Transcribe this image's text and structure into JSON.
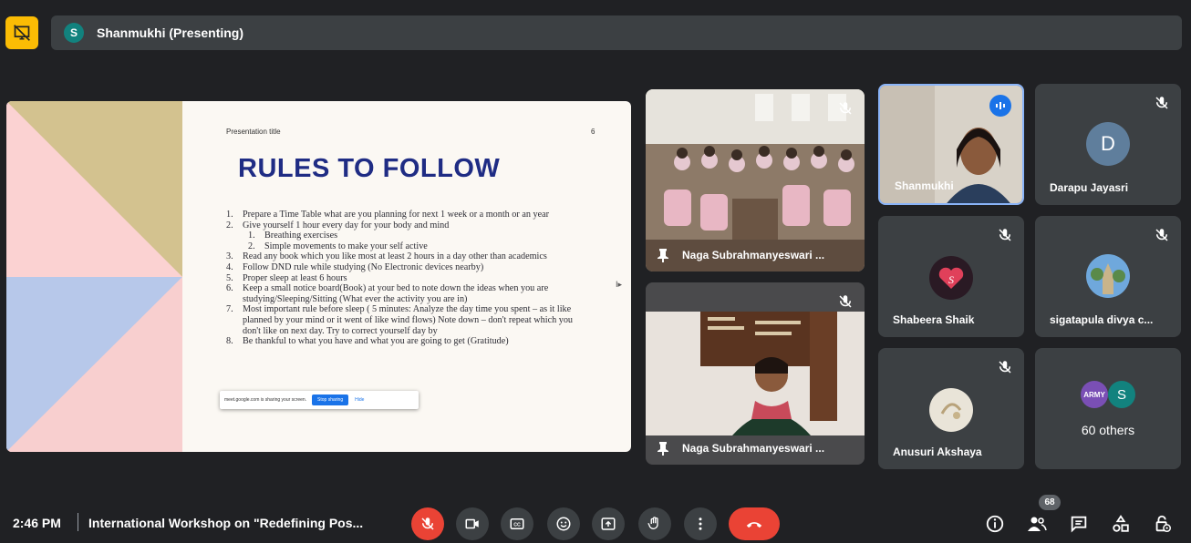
{
  "presenter_bar": {
    "avatar_letter": "S",
    "label": "Shanmukhi (Presenting)"
  },
  "slide": {
    "meta_title": "Presentation title",
    "page_number": "6",
    "heading": "RULES TO FOLLOW",
    "rules": [
      {
        "n": "1.",
        "text": "Prepare a Time Table what are you planning for next 1 week or a month or an year"
      },
      {
        "n": "2.",
        "text": "Give yourself 1 hour every day for your body and mind"
      },
      {
        "n": "1.",
        "text": "Breathing exercises",
        "sub": true
      },
      {
        "n": "2.",
        "text": "Simple movements to make your self active",
        "sub": true
      },
      {
        "n": "3.",
        "text": "Read any book which you like most at least 2 hours in a day other than academics"
      },
      {
        "n": "4.",
        "text": "Follow DND rule while studying (No Electronic devices nearby)"
      },
      {
        "n": "5.",
        "text": "Proper sleep at least 6 hours"
      },
      {
        "n": "6.",
        "text": "Keep a small notice board(Book) at your bed to note down the ideas when you are studying/Sleeping/Sitting (What ever the activity you are in)"
      },
      {
        "n": "7.",
        "text": "Most important rule before sleep ( 5 minutes: Analyze the day time you spent – as it like planned by your mind or it went of like wind flows) Note down – don't repeat which you don't like on next day. Try to correct yourself day by"
      },
      {
        "n": "8.",
        "text": "Be thankful to what you have and what you are going to get (Gratitude)"
      }
    ],
    "share_notice": {
      "text": "meet.google.com is sharing your screen.",
      "stop_label": "Stop sharing",
      "hide_label": "Hide"
    }
  },
  "tiles": {
    "classroom": {
      "name": "Naga Subrahmanyeswari ..."
    },
    "teacher": {
      "name": "Naga Subrahmanyeswari ..."
    },
    "shanmukhi": {
      "name": "Shanmukhi"
    },
    "darapu": {
      "name": "Darapu Jayasri",
      "initial": "D",
      "color": "#5f7e9c"
    },
    "shabeera": {
      "name": "Shabeera Shaik"
    },
    "sigatapula": {
      "name": "sigatapula divya c..."
    },
    "anusuri": {
      "name": "Anusuri Akshaya"
    },
    "others": {
      "label": "60 others",
      "initial": "S",
      "tag": "ARMY"
    }
  },
  "bottom_bar": {
    "time": "2:46 PM",
    "meeting_title": "International Workshop on \"Redefining Pos...",
    "participant_count": "68"
  },
  "icons": {
    "mic": "mic-off-icon",
    "camera": "camera-icon",
    "captions": "captions-icon",
    "emoji": "emoji-icon",
    "present": "present-screen-icon",
    "hand": "raise-hand-icon",
    "more": "more-vert-icon",
    "leave": "end-call-icon",
    "info": "info-icon",
    "people": "people-icon",
    "chat": "chat-icon",
    "activities": "activities-icon",
    "host": "host-controls-icon"
  },
  "colors": {
    "accent": "#1a73e8",
    "danger": "#ea4335",
    "pin": "#fbbc04",
    "tile": "#3c4043",
    "background": "#202124"
  }
}
